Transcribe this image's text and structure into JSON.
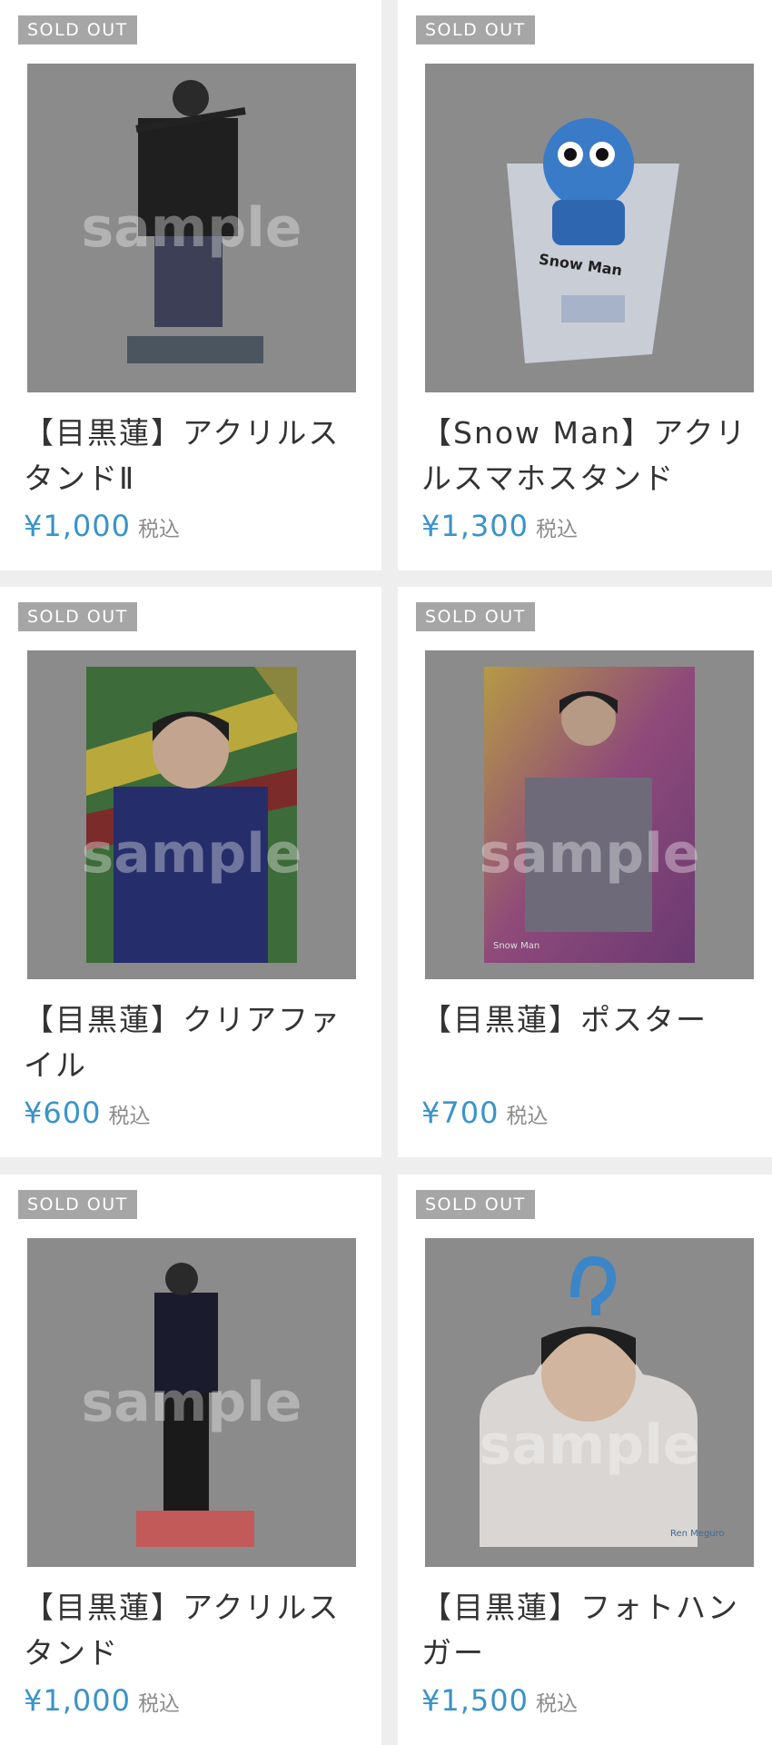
{
  "products": [
    {
      "badge": "SOLD OUT",
      "title": "【目黒蓮】アクリルスタンドⅡ",
      "price": "¥1,000",
      "tax": "税込",
      "watermark": "sample"
    },
    {
      "badge": "SOLD OUT",
      "title": "【Snow Man】アクリルスマホスタンド",
      "price": "¥1,300",
      "tax": "税込",
      "watermark": "sample",
      "image_text": "Snow Man"
    },
    {
      "badge": "SOLD OUT",
      "title": "【目黒蓮】クリアファイル",
      "price": "¥600",
      "tax": "税込",
      "watermark": "sample"
    },
    {
      "badge": "SOLD OUT",
      "title": "【目黒蓮】ポスター",
      "price": "¥700",
      "tax": "税込",
      "watermark": "sample",
      "image_text": "Snow Man"
    },
    {
      "badge": "SOLD OUT",
      "title": "【目黒蓮】アクリルスタンド",
      "price": "¥1,000",
      "tax": "税込",
      "watermark": "sample"
    },
    {
      "badge": "SOLD OUT",
      "title": "【目黒蓮】フォトハンガー",
      "price": "¥1,500",
      "tax": "税込",
      "watermark": "sample",
      "image_text": "Ren Meguro"
    }
  ],
  "colors": {
    "price": "#3a93c9",
    "badge_bg": "#a6a6a6",
    "page_bg": "#eeeeee"
  }
}
